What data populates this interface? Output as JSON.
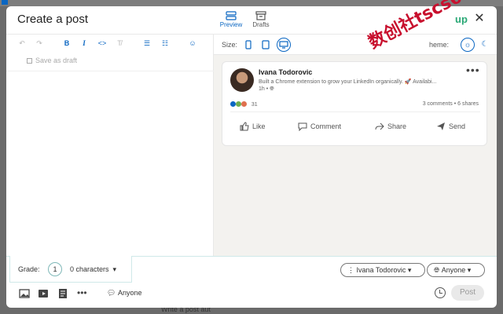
{
  "modal": {
    "title": "Create a post",
    "close_icon": "close-icon",
    "brand_logo": "up"
  },
  "tabs": [
    {
      "label": "Preview",
      "icon": "preview-icon",
      "active": true
    },
    {
      "label": "Drafts",
      "icon": "drafts-icon",
      "active": false
    }
  ],
  "editor": {
    "toolbar": [
      "undo-icon",
      "redo-icon",
      "bold-icon",
      "italic-icon",
      "code-icon",
      "clear-format-icon",
      "bullet-list-icon",
      "numbered-list-icon",
      "emoji-icon"
    ],
    "save_as_draft": "Save as draft"
  },
  "preview": {
    "size_label": "Size:",
    "devices": [
      "mobile-icon",
      "tablet-icon",
      "desktop-icon"
    ],
    "theme_label": "heme:",
    "post": {
      "author": "Ivana Todorovic",
      "headline": "Built a Chrome extension to grow your LinkedIn organically. 🚀 Availabi...",
      "time": "1h •",
      "reaction_count": "31",
      "stats": "3 comments • 6 shares",
      "actions": [
        "Like",
        "Comment",
        "Share",
        "Send"
      ]
    }
  },
  "watermark": "数创社tscs66",
  "bottom": {
    "grade_label": "Grade:",
    "grade_value": "1",
    "characters": "0 characters",
    "author_select": "Ivana Todorovic",
    "audience_select": "Anyone",
    "footer_audience": "Anyone",
    "post_button": "Post"
  },
  "background": {
    "snippet": "Write a post aut"
  },
  "colors": {
    "accent": "#0a66c2",
    "brand": "#2aa876",
    "grade_border": "#cfe9e9"
  }
}
